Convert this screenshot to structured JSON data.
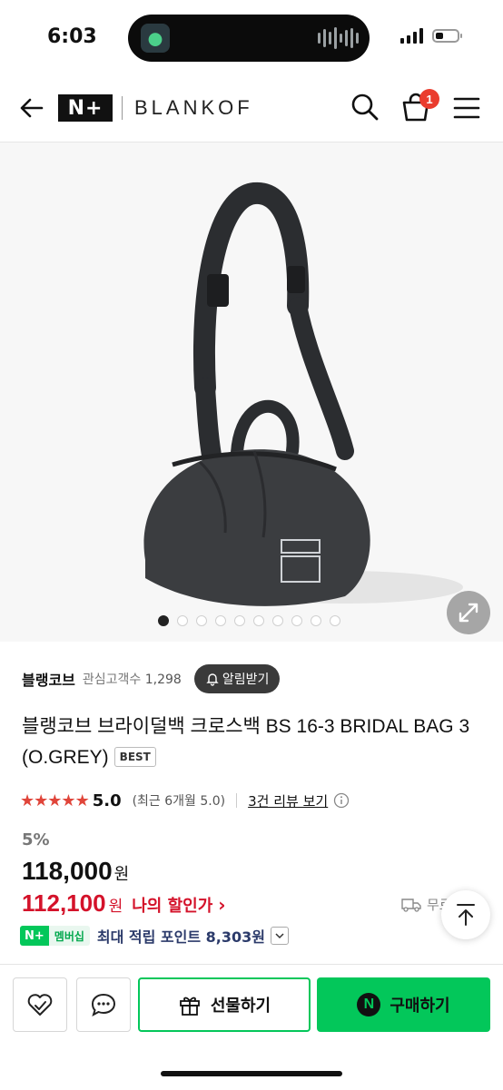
{
  "status_bar": {
    "time": "6:03",
    "battery_level": 0.35
  },
  "header": {
    "logo_mark": "N+",
    "brand": "BLANKOF",
    "cart_count": "1",
    "icons": [
      "back-arrow-icon",
      "search-icon",
      "cart-icon",
      "menu-icon"
    ]
  },
  "gallery": {
    "image": "black crossbody bag",
    "slide_count": 10,
    "active_index": 0,
    "zoom_icon": "expand-icon"
  },
  "seller": {
    "name": "블랭코브",
    "interest_label": "관심고객수",
    "interest_count": "1,298",
    "alert_label": "알림받기"
  },
  "product": {
    "title": "블랭코브 브라이덜백 크로스백 BS 16-3 BRIDAL BAG 3 (O.GREY)",
    "badge": "BEST"
  },
  "rating": {
    "stars": 5,
    "score": "5.0",
    "recent": "(최근 6개월 5.0)",
    "review_link": "3건 리뷰 보기"
  },
  "price": {
    "discount_rate": "5%",
    "original": "118,000",
    "original_unit": "원",
    "sale": "112,100",
    "sale_unit": "원",
    "my_discount_label": "나의 할인가",
    "shipping": "무료"
  },
  "points": {
    "membership_left": "N+",
    "membership_right": "멤버십",
    "text": "최대 적립 포인트 8,303원"
  },
  "bottom_bar": {
    "gift_label": "선물하기",
    "buy_label": "구매하기",
    "buy_mark": "N"
  },
  "colors": {
    "naver_green": "#03c75a",
    "sale_red": "#d4122a",
    "star_red": "#e0453a",
    "badge_red": "#ea3c2e"
  }
}
